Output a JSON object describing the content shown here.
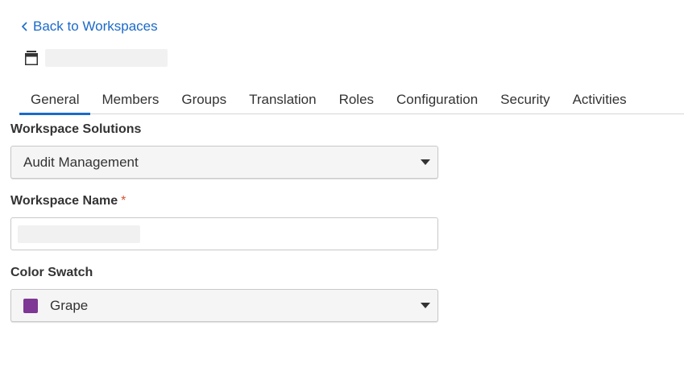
{
  "back_link": {
    "label": "Back to Workspaces"
  },
  "tabs": [
    {
      "label": "General",
      "active": true
    },
    {
      "label": "Members",
      "active": false
    },
    {
      "label": "Groups",
      "active": false
    },
    {
      "label": "Translation",
      "active": false
    },
    {
      "label": "Roles",
      "active": false
    },
    {
      "label": "Configuration",
      "active": false
    },
    {
      "label": "Security",
      "active": false
    },
    {
      "label": "Activities",
      "active": false
    }
  ],
  "form": {
    "solutions": {
      "label": "Workspace Solutions",
      "value": "Audit Management"
    },
    "name": {
      "label": "Workspace Name",
      "required_marker": "*",
      "value": ""
    },
    "color": {
      "label": "Color Swatch",
      "value": "Grape",
      "swatch_color": "#7e3794"
    }
  },
  "colors": {
    "accent": "#1b6ac9",
    "required": "#d9532f"
  },
  "icons": {
    "back": "chevron-left-icon",
    "workspace": "workspace-icon",
    "dropdown": "caret-down-icon"
  }
}
